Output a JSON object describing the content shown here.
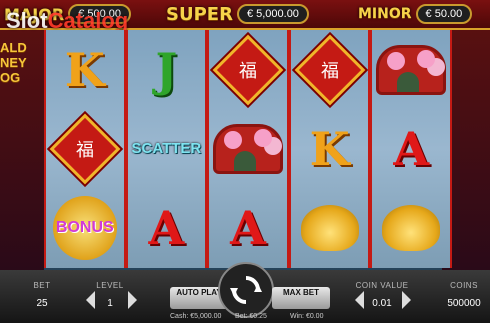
{
  "jackpots": {
    "major_label": "MAJOR",
    "major_value": "€ 500.00",
    "super_label": "SUPER",
    "super_value": "€ 5,000.00",
    "minor_label": "MINOR",
    "minor_value": "€ 50.00"
  },
  "watermark": {
    "slot": "Slot",
    "catalog": "Catalog"
  },
  "game_title": "ALD\nNEY\nOG",
  "reels": [
    [
      "K",
      "kite",
      "bonus"
    ],
    [
      "J",
      "scatter",
      "A"
    ],
    [
      "kite",
      "bridge",
      "A"
    ],
    [
      "kite",
      "K",
      "gold"
    ],
    [
      "bridge",
      "A",
      "gold"
    ]
  ],
  "symbols": {
    "scatter_text": "SCATTER",
    "bonus_text": "BONUS",
    "kite_glyph": "福"
  },
  "controls": {
    "bet_label": "BET",
    "bet_value": "25",
    "level_label": "LEVEL",
    "level_value": "1",
    "autoplay_label": "AUTO PLAY",
    "maxbet_label": "MAX BET",
    "coin_value_label": "COIN VALUE",
    "coin_value": "0.01",
    "coins_label": "COINS",
    "coins_value": "500000"
  },
  "footer": {
    "cash": "Cash: €5,000.00",
    "bet": "Bet: €0.25",
    "win": "Win: €0.00"
  }
}
